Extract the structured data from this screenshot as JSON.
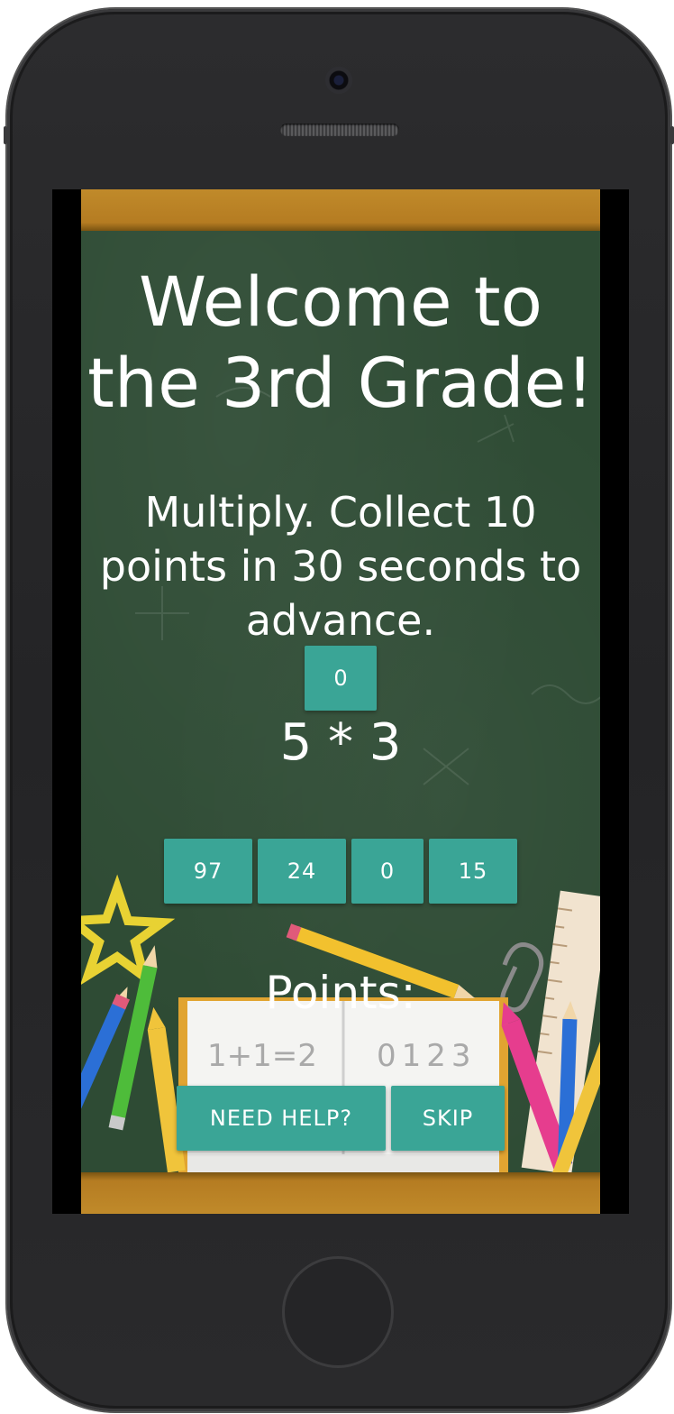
{
  "game": {
    "title_line1": "Welcome to",
    "title_line2": "the 3rd Grade!",
    "instructions": "Multiply. Collect 10 points in 30 seconds to advance.",
    "timer": "0",
    "problem": "5 * 3",
    "answers": [
      "97",
      "24",
      "0",
      "15"
    ],
    "points_label": "Points:",
    "help_label": "NEED HELP?",
    "skip_label": "SKIP"
  },
  "illustration": {
    "notebook_left": "1+1=2",
    "notebook_right": "0123"
  },
  "colors": {
    "chalkboard": "#2e4b34",
    "frame": "#b57c22",
    "button": "#3aa596",
    "text": "#ffffff"
  }
}
